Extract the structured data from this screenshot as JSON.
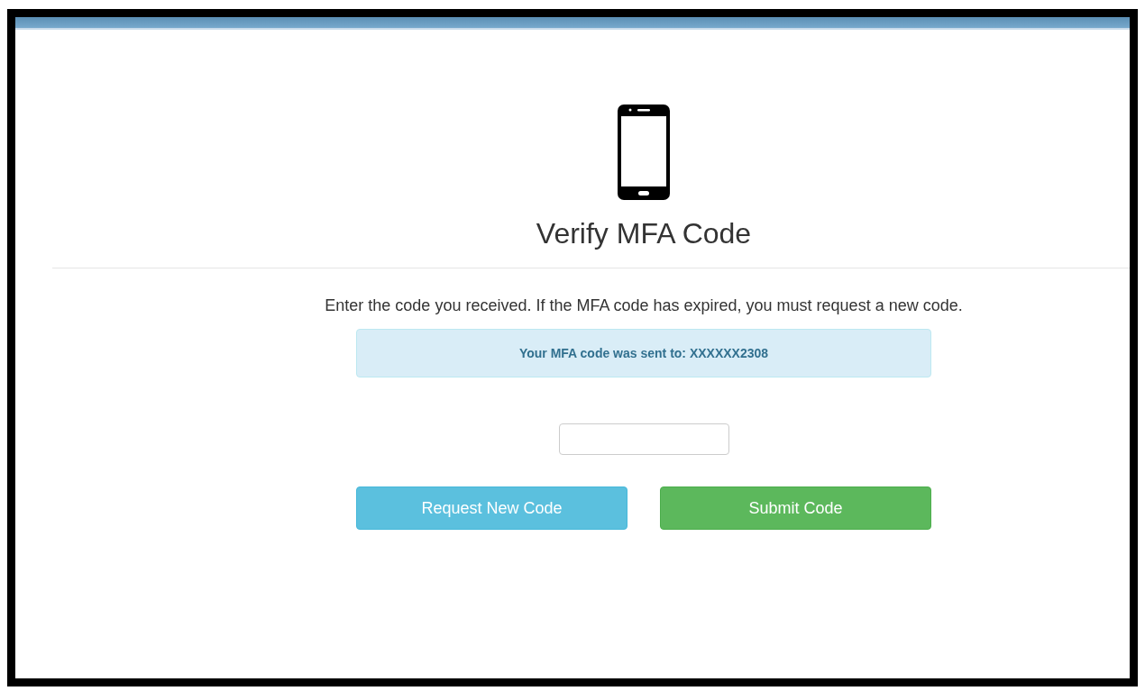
{
  "title": "Verify MFA Code",
  "instructions": "Enter the code you received. If the MFA code has expired, you must request a new code.",
  "alert": "Your MFA code was sent to: XXXXXX2308",
  "buttons": [
    {
      "label": "Request New Code",
      "kind": "info"
    },
    {
      "label": "Submit Code",
      "kind": "success"
    }
  ]
}
